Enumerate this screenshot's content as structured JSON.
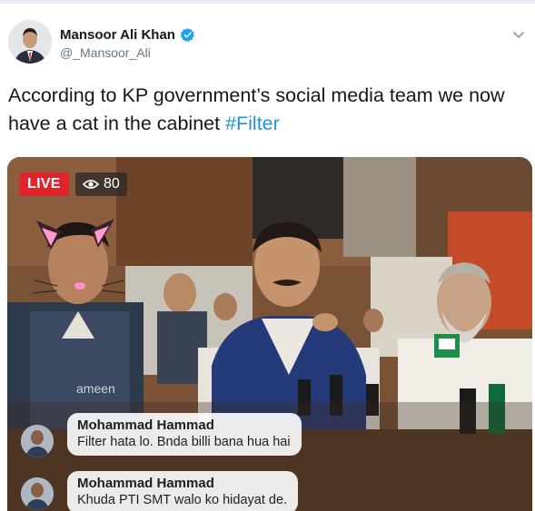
{
  "tweet": {
    "author_name": "Mansoor Ali Khan",
    "author_handle": "@_Mansoor_Ali",
    "text_before": "According to KP government’s social media team we now have a cat in the cabinet ",
    "hashtag": "#Filter"
  },
  "video": {
    "live_label": "LIVE",
    "viewer_count": "80",
    "ghost_comment": "ameen",
    "comments": [
      {
        "author": "Mohammad Hammad",
        "text": "Filter hata lo. Bnda billi bana hua hai"
      },
      {
        "author": "Mohammad Hammad",
        "text": "Khuda PTI SMT walo ko hidayat de."
      }
    ]
  },
  "colors": {
    "hashtag": "#1b95e0",
    "live": "#e0242b",
    "verified": "#1da1f2"
  }
}
